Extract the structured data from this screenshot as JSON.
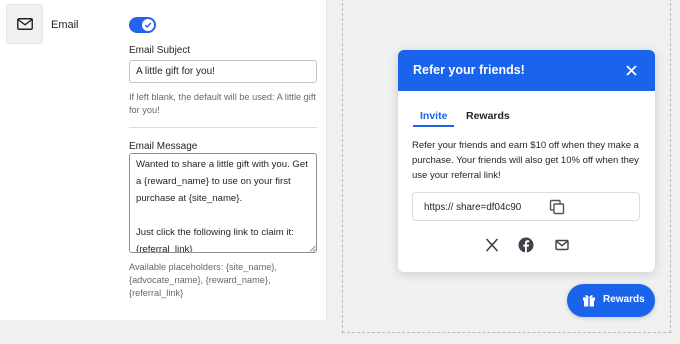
{
  "channel": {
    "name": "Email",
    "icon": "envelope-icon",
    "enabled": true
  },
  "subject": {
    "label": "Email Subject",
    "value": "A little gift for you!",
    "help": "If left blank, the default will be used: A little gift for you!"
  },
  "message": {
    "label": "Email Message",
    "value": "Wanted to share a little gift with you. Get a {reward_name} to use on your first purchase at {site_name}.\n\nJust click the following link to claim it: {referral_link}",
    "help": "Available placeholders: {site_name}, {advocate_name}, {reward_name}, {referral_link}"
  },
  "modal": {
    "title": "Refer your friends!",
    "tabs": [
      "Invite",
      "Rewards"
    ],
    "active_tab": "Invite",
    "body": "Refer your friends and earn $10 off when they make a purchase. Your friends will also get 10% off when they use your referral link!",
    "link": "https:// share=df04c90",
    "share_icons": [
      "x-icon",
      "facebook-icon",
      "email-icon"
    ]
  },
  "launcher": {
    "label": "Rewards",
    "icon": "gift-icon"
  },
  "colors": {
    "brand_blue": "#1a63eb",
    "toggle_blue": "#2563eb"
  }
}
